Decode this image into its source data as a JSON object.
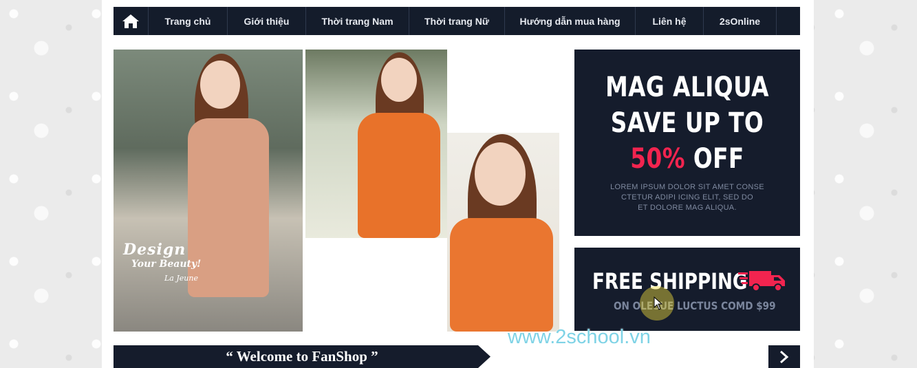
{
  "nav": {
    "home_icon": "home-icon",
    "items": [
      {
        "label": "Trang chủ"
      },
      {
        "label": "Giới thiệu"
      },
      {
        "label": "Thời trang Nam"
      },
      {
        "label": "Thời trang Nữ"
      },
      {
        "label": "Hướng dẫn mua hàng"
      },
      {
        "label": "Liên hệ"
      },
      {
        "label": "2sOnline"
      }
    ]
  },
  "hero": {
    "design_line1": "Design",
    "design_line2": "Your Beauty!",
    "design_line3": "La Jeune"
  },
  "promo": {
    "line1": "MAG ALIQUA",
    "line2": "SAVE UP TO",
    "percent": "50%",
    "off": "OFF",
    "body_line1": "LOREM IPSUM DOLOR SIT AMET CONSE",
    "body_line2": "CTETUR ADIPI ICING ELIT, SED DO",
    "body_line3": "ET DOLORE MAG ALIQUA."
  },
  "shipping": {
    "title": "FREE SHIPPING",
    "subtitle": "ON OLESUE LUCTUS COMD $99",
    "icon": "delivery-truck-icon"
  },
  "welcome": {
    "label": "“ Welcome to FanShop ”",
    "next_icon": "chevron-right-icon"
  },
  "watermark": "www.2school.vn",
  "colors": {
    "navy": "#151c2c",
    "accent_red": "#f2244f",
    "muted_text": "#7f8aa0"
  }
}
